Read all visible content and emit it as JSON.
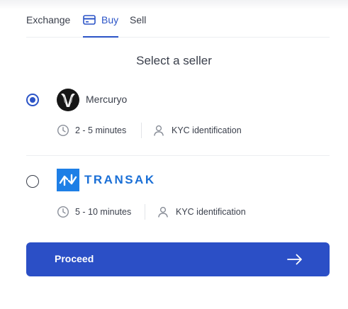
{
  "tabs": [
    {
      "label": "Exchange",
      "active": false
    },
    {
      "label": "Buy",
      "active": true,
      "icon": "credit-card-icon"
    },
    {
      "label": "Sell",
      "active": false
    }
  ],
  "title": "Select a seller",
  "sellers": [
    {
      "name": "Mercuryo",
      "selected": true,
      "logo": "mercuryo-logo",
      "time": "2 - 5 minutes",
      "kyc": "KYC identification"
    },
    {
      "name": "TRANSAK",
      "selected": false,
      "logo": "transak-logo",
      "time": "5 - 10 minutes",
      "kyc": "KYC identification"
    }
  ],
  "proceed": {
    "label": "Proceed",
    "icon": "arrow-right-icon"
  },
  "colors": {
    "accent": "#2b4fc6",
    "transak": "#1e7fe6"
  }
}
